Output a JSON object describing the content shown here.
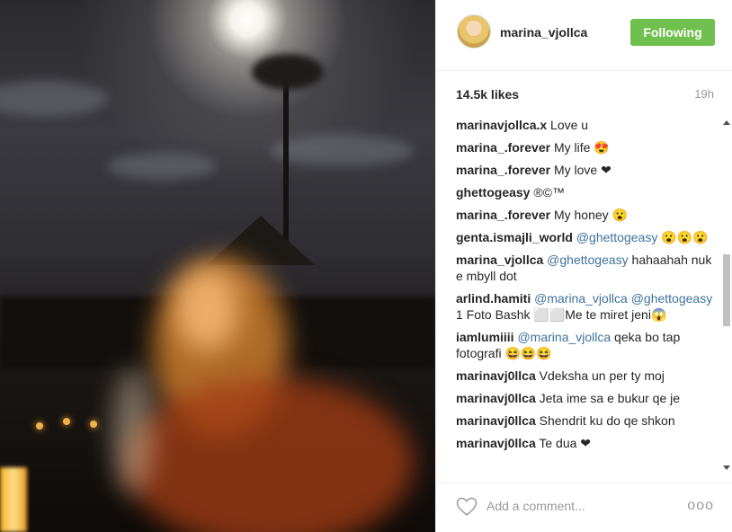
{
  "post": {
    "username": "marina_vjollca",
    "follow_label": "Following",
    "likes": "14.5k likes",
    "time": "19h"
  },
  "comments": [
    {
      "user": "marinavjollca.x",
      "text": " Love u"
    },
    {
      "user": "marina_.forever",
      "text": " My life 😍"
    },
    {
      "user": "marina_.forever",
      "text": " My love ❤"
    },
    {
      "user": "ghettogeasy",
      "text": " ®©™"
    },
    {
      "user": "marina_.forever",
      "text": " My honey 😮"
    },
    {
      "user": "genta.ismajli_world",
      "mention": "@ghettogeasy",
      "text": " 😮😮😮"
    },
    {
      "user": "marina_vjollca",
      "mention": "@ghettogeasy",
      "text": " hahaahah nuk e mbyll dot"
    },
    {
      "user": "arlind.hamiti",
      "mention": "@marina_vjollca @ghettogeasy",
      "text": " 1 Foto Bashk ⬜⬜Me te miret jeni😱"
    },
    {
      "user": "iamlumiiii",
      "mention": "@marina_vjollca",
      "text": " qeka bo tap fotografi 😆😆😆"
    },
    {
      "user": "marinavj0llca",
      "text": " Vdeksha un per ty moj"
    },
    {
      "user": "marinavj0llca",
      "text": " Jeta ime sa e bukur qe je"
    },
    {
      "user": "marinavj0llca",
      "text": " Shendrit ku do qe shkon"
    },
    {
      "user": "marinavj0llca",
      "text": " Te dua ❤"
    }
  ],
  "add_comment": {
    "placeholder": "Add a comment..."
  },
  "more_label": "ooo",
  "icons": {
    "like": "heart-outline-icon",
    "more": "more-options-icon"
  },
  "colors": {
    "follow_button": "#70c050",
    "mention": "#3f729b"
  }
}
